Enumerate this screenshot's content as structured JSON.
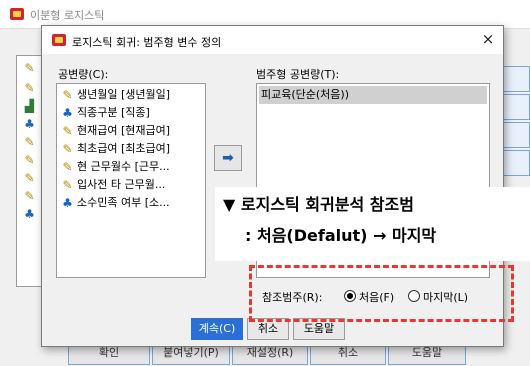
{
  "background_window": {
    "title": "이분형 로지스틱",
    "bottom_buttons": [
      "확인",
      "붙여넣기(P)",
      "재설정(R)",
      "취소",
      "도움말"
    ]
  },
  "dialog": {
    "title": "로지스틱 회귀: 범주형 변수 정의",
    "close": "×",
    "covariates_label": "공변량(C):",
    "covariates": [
      {
        "icon": "ruler-icon",
        "label": "생년월일 [생년월일]"
      },
      {
        "icon": "nominal-icon",
        "label": "직종구분 [직종]"
      },
      {
        "icon": "ruler-icon",
        "label": "현재급여 [현재급여]"
      },
      {
        "icon": "ruler-icon",
        "label": "최초급여 [최초급여]"
      },
      {
        "icon": "ruler-icon",
        "label": "현 근무월수 [근무..."
      },
      {
        "icon": "ruler-icon",
        "label": "입사전 타 근무월..."
      },
      {
        "icon": "nominal-icon",
        "label": "소수민족 여부 [소..."
      }
    ],
    "move_arrow": "➡",
    "categorical_label": "범주형 공변량(T):",
    "categorical_items": [
      "피교육(단순(처음))"
    ],
    "reference_label": "참조범주(R):",
    "reference_options": [
      {
        "label": "처음(F)",
        "selected": true
      },
      {
        "label": "마지막(L)",
        "selected": false
      }
    ],
    "buttons": {
      "continue": "계속(C)",
      "cancel": "취소",
      "help": "도움말"
    }
  },
  "annotation": {
    "line1": "▼ 로지스틱 회귀분석 참조범",
    "line2": ": 처음(Defalut) → 마지막"
  },
  "colors": {
    "accent": "#2a6fd6",
    "highlight_border": "#e53935"
  }
}
